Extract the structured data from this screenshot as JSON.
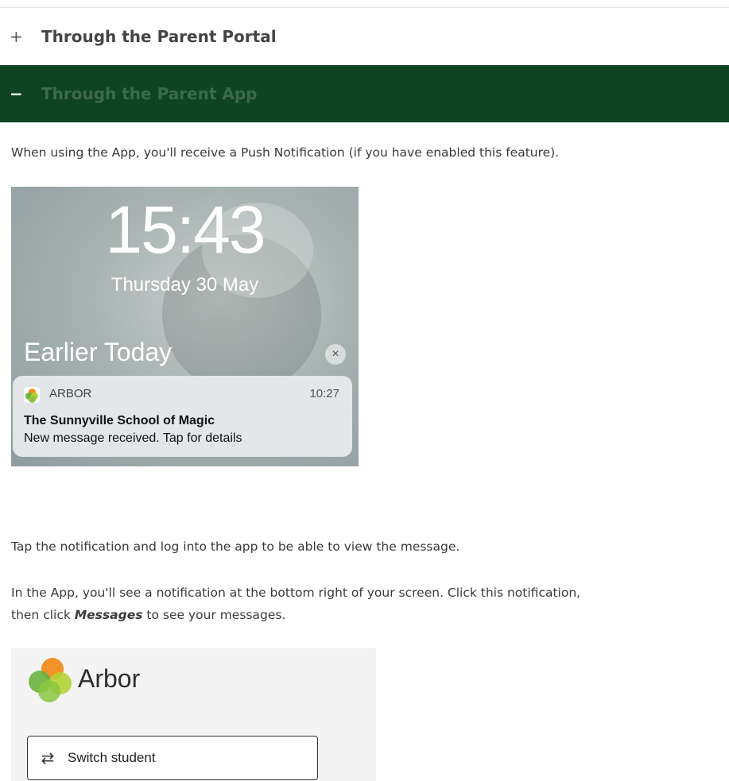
{
  "accordion": {
    "collapsed_sign": "+",
    "portal_title": "Through the Parent Portal",
    "expanded_sign": "−",
    "app_title": "Through the Parent App"
  },
  "content": {
    "intro": "When using the App, you'll receive a Push Notification (if you have enabled this feature).",
    "tap_text": "Tap the notification and log into the app to be able to view the message.",
    "app_line1": "In the App, you'll see a notification at the bottom right of your screen. Click this notification,",
    "app_line2_prefix": "then click ",
    "app_line2_bold": "Messages",
    "app_line2_suffix": " to see your messages."
  },
  "lockscreen": {
    "time": "15:43",
    "date": "Thursday 30 May",
    "section_title": "Earlier Today",
    "clear_icon": "×",
    "notification": {
      "app_name": "ARBOR",
      "time": "10:27",
      "title": "The Sunnyville School of Magic",
      "body": "New message received. Tap for details"
    }
  },
  "arbor_app": {
    "brand": "Arbor",
    "switch_icon": "⇄",
    "switch_label": "Switch student"
  },
  "colors": {
    "accordion_active_bg": "#0e4424",
    "logo_orange": "#f28c1e",
    "logo_green": "#6cb33f",
    "logo_lime": "#b5d334"
  }
}
